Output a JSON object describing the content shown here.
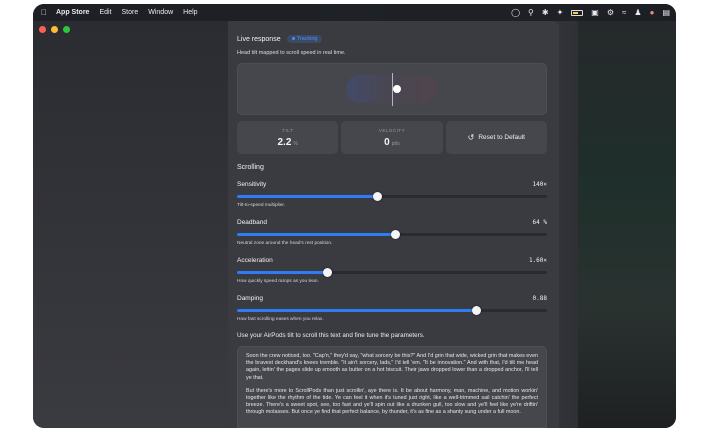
{
  "menubar": {
    "app": "App Store",
    "menus": [
      "Edit",
      "Store",
      "Window",
      "Help"
    ],
    "status_icons": [
      "airpods-icon",
      "search-icon",
      "bluetooth-icon",
      "lightning-icon",
      "battery-icon",
      "screen-icon",
      "gear-icon",
      "wifi-icon",
      "user-icon",
      "color-icon",
      "control-center-icon"
    ]
  },
  "header": {
    "title": "Live response",
    "badge": "Tracking",
    "subtitle": "Head tilt mapped to scroll speed in real time."
  },
  "stats": {
    "tilt_label": "TILT",
    "tilt_value": "2.2",
    "tilt_unit": "%",
    "velocity_label": "VELOCITY",
    "velocity_value": "0",
    "velocity_unit": "pt/s",
    "reset_label": "Reset to Default"
  },
  "scrolling": {
    "title": "Scrolling",
    "params": [
      {
        "name": "Sensitivity",
        "value": "140×",
        "help": "Tilt-to-speed multiplier.",
        "fraction": 0.45
      },
      {
        "name": "Deadband",
        "value": "64 %",
        "help": "Neutral zone around the head's rest position.",
        "fraction": 0.51
      },
      {
        "name": "Acceleration",
        "value": "1.60×",
        "help": "How quickly speed ramps as you lean.",
        "fraction": 0.29
      },
      {
        "name": "Damping",
        "value": "0.88",
        "help": "How fast scrolling eases when you relax.",
        "fraction": 0.77
      }
    ]
  },
  "instruction": "Use your AirPods tilt to scroll this text and fine tune the parameters.",
  "story": [
    "Soon the crew noticed, too. \"Cap'n,\" they'd say, \"what sorcery be this?\" And I'd grin that wide, wicked grin that makes even the bravest deckhand's knees tremble. \"It ain't sorcery, lads,\" I'd tell 'em. \"It be innovation.\" And with that, I'd tilt me head again, lettin' the pages slide up smooth as butter on a hot biscuit. Their jaws dropped lower than a dropped anchor, I'll tell ye that.",
    "But there's more to ScrollPods than just scrollin', aye there is. It be about harmony, man, machine, and motion workin' together like the rhythm of the tide. Ye can feel it when it's tuned just right, like a well-trimmed sail catchin' the perfect breeze. There's a sweet spot, see, too fast and ye'll spin out like a drunken gull, too slow and ye'll feel like ye're driftin' through molasses. But once ye find that perfect balance, by thunder, it's as fine as a shanty sung under a full moon."
  ],
  "colors": {
    "accent": "#2f7df6",
    "panel": "#3a3b41",
    "card": "#46474d"
  }
}
